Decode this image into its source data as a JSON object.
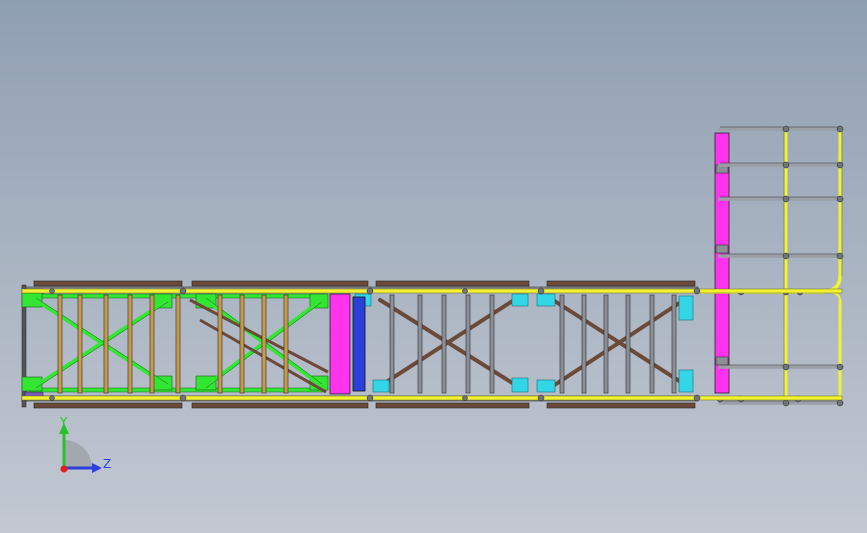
{
  "colors": {
    "background_top": "#8f9fb2",
    "background_bottom": "#c3c8d2",
    "rail_yellow": "#f2f233",
    "truss_green": "#33e633",
    "brace_brown": "#6b4a3a",
    "gusset_cyan": "#33d6e6",
    "panel_magenta": "#ff33ee",
    "panel_blue": "#2b3fd9",
    "steel_gray": "#8c9096",
    "tread_orange": "#c89a4a",
    "end_purple": "#7a5ab8"
  },
  "triad": {
    "y_label": "Y",
    "z_label": "Z",
    "y_color": "#27c227",
    "z_color": "#2b3fe0",
    "x_color": "#e02020"
  }
}
